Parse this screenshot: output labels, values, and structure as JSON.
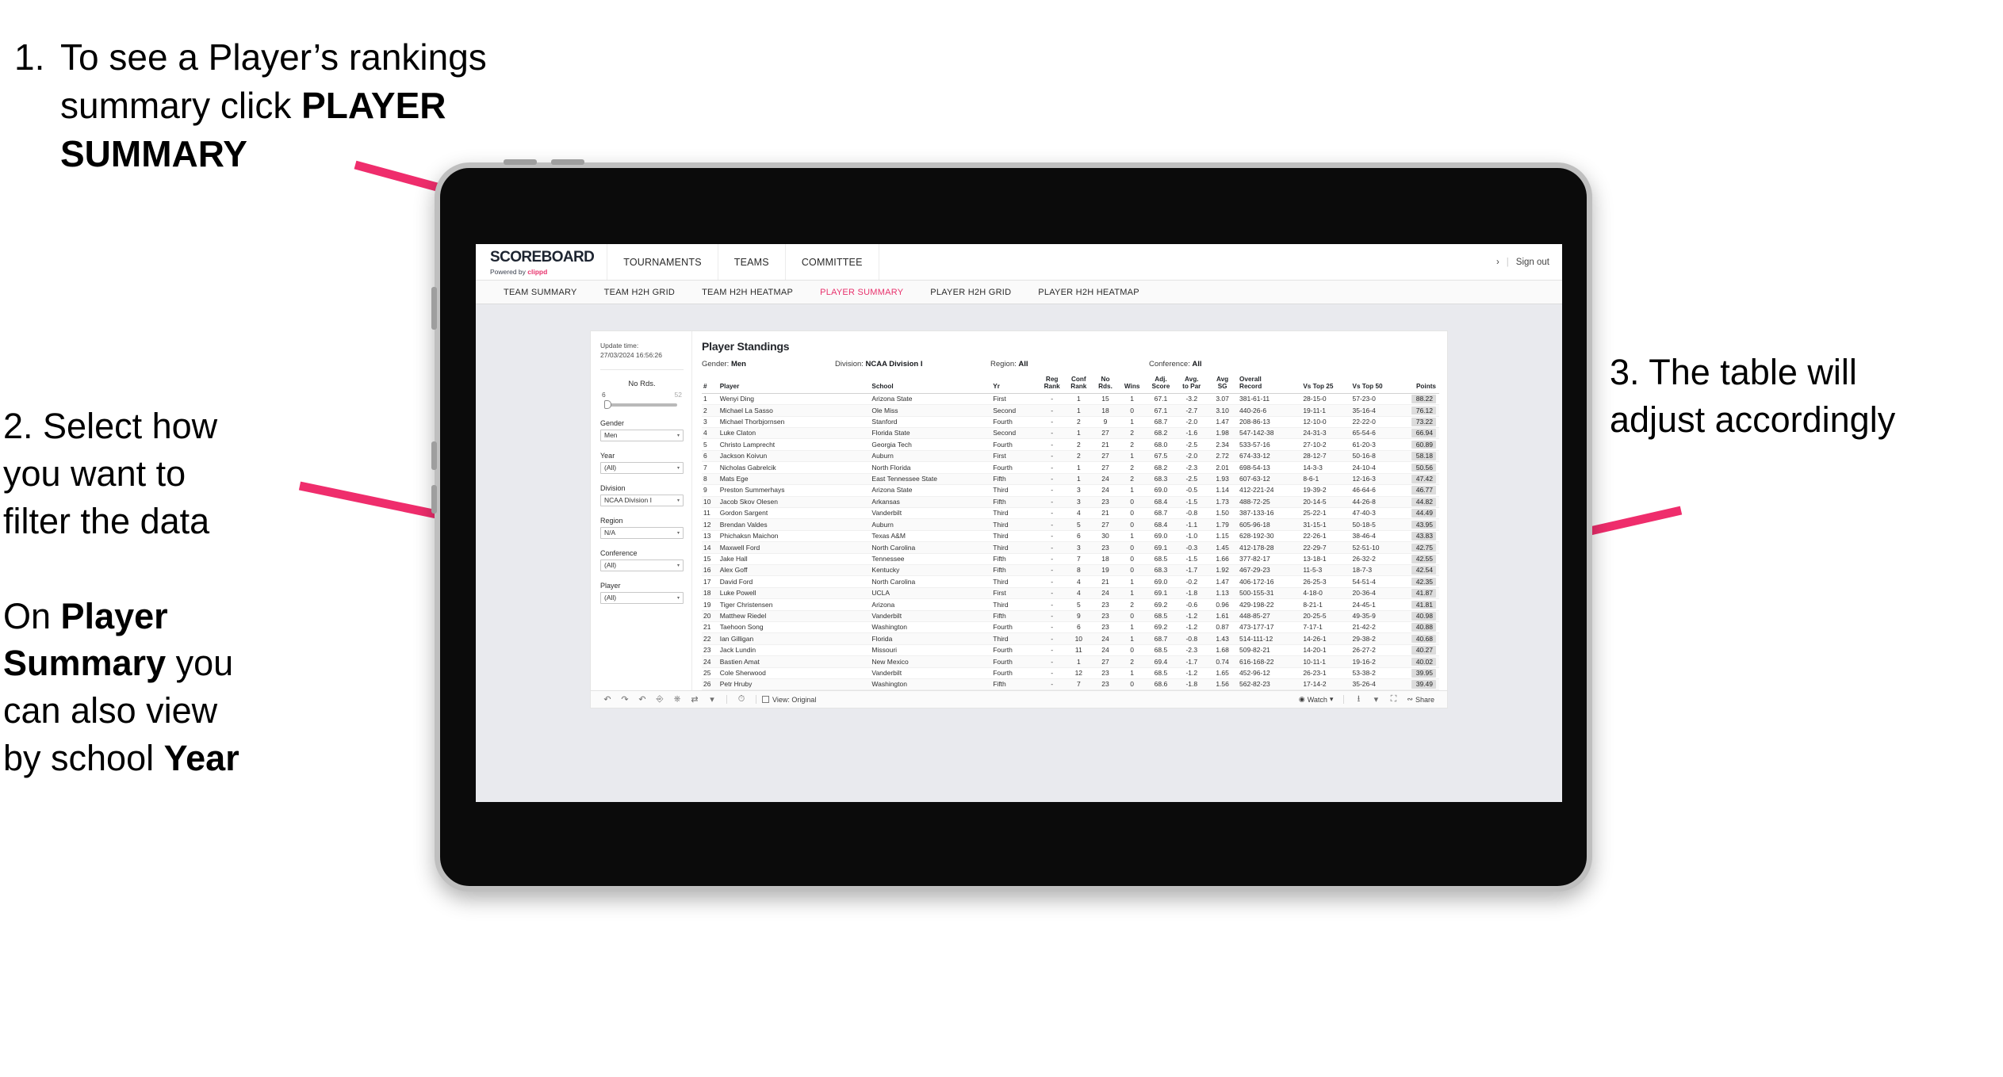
{
  "annotations": {
    "a1_number": "1.",
    "a1_line1": "To see a Player’s rankings",
    "a1_line2_pre": "summary click ",
    "a1_line2_bold": "PLAYER",
    "a1_line3_bold": "SUMMARY",
    "a2_line1": "2. Select how",
    "a2_line2": "you want to",
    "a2_line3": "filter the data",
    "a2_p2_pre": "On ",
    "a2_p2_bold1": "Player",
    "a2_p2_bold2": "Summary",
    "a2_p2_mid": " you",
    "a2_p2_line3": "can also view",
    "a2_p2_line4_pre": "by school ",
    "a2_p2_bold3": "Year",
    "a3_line1": "3. The table will",
    "a3_line2": "adjust accordingly"
  },
  "app": {
    "brand": {
      "logo": "SCOREBOARD",
      "powered_pre": "Powered by ",
      "powered_brand": "clippd"
    },
    "nav": [
      {
        "label": "TOURNAMENTS"
      },
      {
        "label": "TEAMS"
      },
      {
        "label": "COMMITTEE"
      }
    ],
    "header_right": {
      "chevron": "›",
      "divider": "|",
      "sign_out": "Sign out"
    },
    "subnav": [
      {
        "label": "TEAM SUMMARY",
        "active": false
      },
      {
        "label": "TEAM H2H GRID",
        "active": false
      },
      {
        "label": "TEAM H2H HEATMAP",
        "active": false
      },
      {
        "label": "PLAYER SUMMARY",
        "active": true
      },
      {
        "label": "PLAYER H2H GRID",
        "active": false
      },
      {
        "label": "PLAYER H2H HEATMAP",
        "active": false
      }
    ],
    "accent_color": "#e8336d"
  },
  "filters": {
    "update_label": "Update time:",
    "update_value": "27/03/2024 16:56:26",
    "slider": {
      "label": "No Rds.",
      "min": "6",
      "max": "52",
      "value_pct": 10
    },
    "selects": [
      {
        "label": "Gender",
        "value": "Men"
      },
      {
        "label": "Year",
        "value": "(All)"
      },
      {
        "label": "Division",
        "value": "NCAA Division I"
      },
      {
        "label": "Region",
        "value": "N/A"
      },
      {
        "label": "Conference",
        "value": "(All)"
      },
      {
        "label": "Player",
        "value": "(All)"
      }
    ],
    "caret": "▾"
  },
  "table": {
    "title": "Player Standings",
    "meta": [
      {
        "label": "Gender: ",
        "value": "Men"
      },
      {
        "label": "Division: ",
        "value": "NCAA Division I"
      },
      {
        "label": "Region: ",
        "value": "All"
      },
      {
        "label": "Conference: ",
        "value": "All"
      }
    ],
    "headers": [
      {
        "l1": "#",
        "l2": ""
      },
      {
        "l1": "Player",
        "l2": ""
      },
      {
        "l1": "School",
        "l2": ""
      },
      {
        "l1": "Yr",
        "l2": ""
      },
      {
        "l1": "Reg",
        "l2": "Rank"
      },
      {
        "l1": "Conf",
        "l2": "Rank"
      },
      {
        "l1": "No",
        "l2": "Rds."
      },
      {
        "l1": "Wins",
        "l2": ""
      },
      {
        "l1": "Adj.",
        "l2": "Score"
      },
      {
        "l1": "Avg.",
        "l2": "to Par"
      },
      {
        "l1": "Avg",
        "l2": "SG"
      },
      {
        "l1": "Overall",
        "l2": "Record"
      },
      {
        "l1": "Vs Top 25",
        "l2": ""
      },
      {
        "l1": "Vs Top 50",
        "l2": ""
      },
      {
        "l1": "Points",
        "l2": ""
      }
    ],
    "rows": [
      {
        "n": "1",
        "player": "Wenyi Ding",
        "school": "Arizona State",
        "yr": "First",
        "reg": "-",
        "conf": "1",
        "rds": "15",
        "wins": "1",
        "adj": "67.1",
        "par": "-3.2",
        "sg": "3.07",
        "rec": "381-61-11",
        "t25": "28-15-0",
        "t50": "57-23-0",
        "pts": "88.22"
      },
      {
        "n": "2",
        "player": "Michael La Sasso",
        "school": "Ole Miss",
        "yr": "Second",
        "reg": "-",
        "conf": "1",
        "rds": "18",
        "wins": "0",
        "adj": "67.1",
        "par": "-2.7",
        "sg": "3.10",
        "rec": "440-26-6",
        "t25": "19-11-1",
        "t50": "35-16-4",
        "pts": "76.12"
      },
      {
        "n": "3",
        "player": "Michael Thorbjornsen",
        "school": "Stanford",
        "yr": "Fourth",
        "reg": "-",
        "conf": "2",
        "rds": "9",
        "wins": "1",
        "adj": "68.7",
        "par": "-2.0",
        "sg": "1.47",
        "rec": "208-86-13",
        "t25": "12-10-0",
        "t50": "22-22-0",
        "pts": "73.22"
      },
      {
        "n": "4",
        "player": "Luke Claton",
        "school": "Florida State",
        "yr": "Second",
        "reg": "-",
        "conf": "1",
        "rds": "27",
        "wins": "2",
        "adj": "68.2",
        "par": "-1.6",
        "sg": "1.98",
        "rec": "547-142-38",
        "t25": "24-31-3",
        "t50": "65-54-6",
        "pts": "66.94"
      },
      {
        "n": "5",
        "player": "Christo Lamprecht",
        "school": "Georgia Tech",
        "yr": "Fourth",
        "reg": "-",
        "conf": "2",
        "rds": "21",
        "wins": "2",
        "adj": "68.0",
        "par": "-2.5",
        "sg": "2.34",
        "rec": "533-57-16",
        "t25": "27-10-2",
        "t50": "61-20-3",
        "pts": "60.89"
      },
      {
        "n": "6",
        "player": "Jackson Koivun",
        "school": "Auburn",
        "yr": "First",
        "reg": "-",
        "conf": "2",
        "rds": "27",
        "wins": "1",
        "adj": "67.5",
        "par": "-2.0",
        "sg": "2.72",
        "rec": "674-33-12",
        "t25": "28-12-7",
        "t50": "50-16-8",
        "pts": "58.18"
      },
      {
        "n": "7",
        "player": "Nicholas Gabrelcik",
        "school": "North Florida",
        "yr": "Fourth",
        "reg": "-",
        "conf": "1",
        "rds": "27",
        "wins": "2",
        "adj": "68.2",
        "par": "-2.3",
        "sg": "2.01",
        "rec": "698-54-13",
        "t25": "14-3-3",
        "t50": "24-10-4",
        "pts": "50.56"
      },
      {
        "n": "8",
        "player": "Mats Ege",
        "school": "East Tennessee State",
        "yr": "Fifth",
        "reg": "-",
        "conf": "1",
        "rds": "24",
        "wins": "2",
        "adj": "68.3",
        "par": "-2.5",
        "sg": "1.93",
        "rec": "607-63-12",
        "t25": "8-6-1",
        "t50": "12-16-3",
        "pts": "47.42"
      },
      {
        "n": "9",
        "player": "Preston Summerhays",
        "school": "Arizona State",
        "yr": "Third",
        "reg": "-",
        "conf": "3",
        "rds": "24",
        "wins": "1",
        "adj": "69.0",
        "par": "-0.5",
        "sg": "1.14",
        "rec": "412-221-24",
        "t25": "19-39-2",
        "t50": "46-64-6",
        "pts": "46.77"
      },
      {
        "n": "10",
        "player": "Jacob Skov Olesen",
        "school": "Arkansas",
        "yr": "Fifth",
        "reg": "-",
        "conf": "3",
        "rds": "23",
        "wins": "0",
        "adj": "68.4",
        "par": "-1.5",
        "sg": "1.73",
        "rec": "488-72-25",
        "t25": "20-14-5",
        "t50": "44-26-8",
        "pts": "44.82"
      },
      {
        "n": "11",
        "player": "Gordon Sargent",
        "school": "Vanderbilt",
        "yr": "Third",
        "reg": "-",
        "conf": "4",
        "rds": "21",
        "wins": "0",
        "adj": "68.7",
        "par": "-0.8",
        "sg": "1.50",
        "rec": "387-133-16",
        "t25": "25-22-1",
        "t50": "47-40-3",
        "pts": "44.49"
      },
      {
        "n": "12",
        "player": "Brendan Valdes",
        "school": "Auburn",
        "yr": "Third",
        "reg": "-",
        "conf": "5",
        "rds": "27",
        "wins": "0",
        "adj": "68.4",
        "par": "-1.1",
        "sg": "1.79",
        "rec": "605-96-18",
        "t25": "31-15-1",
        "t50": "50-18-5",
        "pts": "43.95"
      },
      {
        "n": "13",
        "player": "Phichaksn Maichon",
        "school": "Texas A&M",
        "yr": "Third",
        "reg": "-",
        "conf": "6",
        "rds": "30",
        "wins": "1",
        "adj": "69.0",
        "par": "-1.0",
        "sg": "1.15",
        "rec": "628-192-30",
        "t25": "22-26-1",
        "t50": "38-46-4",
        "pts": "43.83"
      },
      {
        "n": "14",
        "player": "Maxwell Ford",
        "school": "North Carolina",
        "yr": "Third",
        "reg": "-",
        "conf": "3",
        "rds": "23",
        "wins": "0",
        "adj": "69.1",
        "par": "-0.3",
        "sg": "1.45",
        "rec": "412-178-28",
        "t25": "22-29-7",
        "t50": "52-51-10",
        "pts": "42.75"
      },
      {
        "n": "15",
        "player": "Jake Hall",
        "school": "Tennessee",
        "yr": "Fifth",
        "reg": "-",
        "conf": "7",
        "rds": "18",
        "wins": "0",
        "adj": "68.5",
        "par": "-1.5",
        "sg": "1.66",
        "rec": "377-82-17",
        "t25": "13-18-1",
        "t50": "26-32-2",
        "pts": "42.55"
      },
      {
        "n": "16",
        "player": "Alex Goff",
        "school": "Kentucky",
        "yr": "Fifth",
        "reg": "-",
        "conf": "8",
        "rds": "19",
        "wins": "0",
        "adj": "68.3",
        "par": "-1.7",
        "sg": "1.92",
        "rec": "467-29-23",
        "t25": "11-5-3",
        "t50": "18-7-3",
        "pts": "42.54"
      },
      {
        "n": "17",
        "player": "David Ford",
        "school": "North Carolina",
        "yr": "Third",
        "reg": "-",
        "conf": "4",
        "rds": "21",
        "wins": "1",
        "adj": "69.0",
        "par": "-0.2",
        "sg": "1.47",
        "rec": "406-172-16",
        "t25": "26-25-3",
        "t50": "54-51-4",
        "pts": "42.35"
      },
      {
        "n": "18",
        "player": "Luke Powell",
        "school": "UCLA",
        "yr": "First",
        "reg": "-",
        "conf": "4",
        "rds": "24",
        "wins": "1",
        "adj": "69.1",
        "par": "-1.8",
        "sg": "1.13",
        "rec": "500-155-31",
        "t25": "4-18-0",
        "t50": "20-36-4",
        "pts": "41.87"
      },
      {
        "n": "19",
        "player": "Tiger Christensen",
        "school": "Arizona",
        "yr": "Third",
        "reg": "-",
        "conf": "5",
        "rds": "23",
        "wins": "2",
        "adj": "69.2",
        "par": "-0.6",
        "sg": "0.96",
        "rec": "429-198-22",
        "t25": "8-21-1",
        "t50": "24-45-1",
        "pts": "41.81"
      },
      {
        "n": "20",
        "player": "Matthew Riedel",
        "school": "Vanderbilt",
        "yr": "Fifth",
        "reg": "-",
        "conf": "9",
        "rds": "23",
        "wins": "0",
        "adj": "68.5",
        "par": "-1.2",
        "sg": "1.61",
        "rec": "448-85-27",
        "t25": "20-25-5",
        "t50": "49-35-9",
        "pts": "40.98"
      },
      {
        "n": "21",
        "player": "Taehoon Song",
        "school": "Washington",
        "yr": "Fourth",
        "reg": "-",
        "conf": "6",
        "rds": "23",
        "wins": "1",
        "adj": "69.2",
        "par": "-1.2",
        "sg": "0.87",
        "rec": "473-177-17",
        "t25": "7-17-1",
        "t50": "21-42-2",
        "pts": "40.88"
      },
      {
        "n": "22",
        "player": "Ian Gilligan",
        "school": "Florida",
        "yr": "Third",
        "reg": "-",
        "conf": "10",
        "rds": "24",
        "wins": "1",
        "adj": "68.7",
        "par": "-0.8",
        "sg": "1.43",
        "rec": "514-111-12",
        "t25": "14-26-1",
        "t50": "29-38-2",
        "pts": "40.68"
      },
      {
        "n": "23",
        "player": "Jack Lundin",
        "school": "Missouri",
        "yr": "Fourth",
        "reg": "-",
        "conf": "11",
        "rds": "24",
        "wins": "0",
        "adj": "68.5",
        "par": "-2.3",
        "sg": "1.68",
        "rec": "509-82-21",
        "t25": "14-20-1",
        "t50": "26-27-2",
        "pts": "40.27"
      },
      {
        "n": "24",
        "player": "Bastien Amat",
        "school": "New Mexico",
        "yr": "Fourth",
        "reg": "-",
        "conf": "1",
        "rds": "27",
        "wins": "2",
        "adj": "69.4",
        "par": "-1.7",
        "sg": "0.74",
        "rec": "616-168-22",
        "t25": "10-11-1",
        "t50": "19-16-2",
        "pts": "40.02"
      },
      {
        "n": "25",
        "player": "Cole Sherwood",
        "school": "Vanderbilt",
        "yr": "Fourth",
        "reg": "-",
        "conf": "12",
        "rds": "23",
        "wins": "1",
        "adj": "68.5",
        "par": "-1.2",
        "sg": "1.65",
        "rec": "452-96-12",
        "t25": "26-23-1",
        "t50": "53-38-2",
        "pts": "39.95"
      },
      {
        "n": "26",
        "player": "Petr Hruby",
        "school": "Washington",
        "yr": "Fifth",
        "reg": "-",
        "conf": "7",
        "rds": "23",
        "wins": "0",
        "adj": "68.6",
        "par": "-1.8",
        "sg": "1.56",
        "rec": "562-82-23",
        "t25": "17-14-2",
        "t50": "35-26-4",
        "pts": "39.49"
      }
    ]
  },
  "toolbar": {
    "icons": [
      "undo-icon",
      "redo-icon",
      "revert-icon",
      "refresh-data-icon",
      "pause-icon",
      "swap-icon",
      "dropdown-caret"
    ],
    "caret": "▾",
    "view_label": "View: Original",
    "watch_label": "Watch",
    "watch_caret": "▾",
    "download_caret": "▾",
    "share_label": "Share"
  }
}
